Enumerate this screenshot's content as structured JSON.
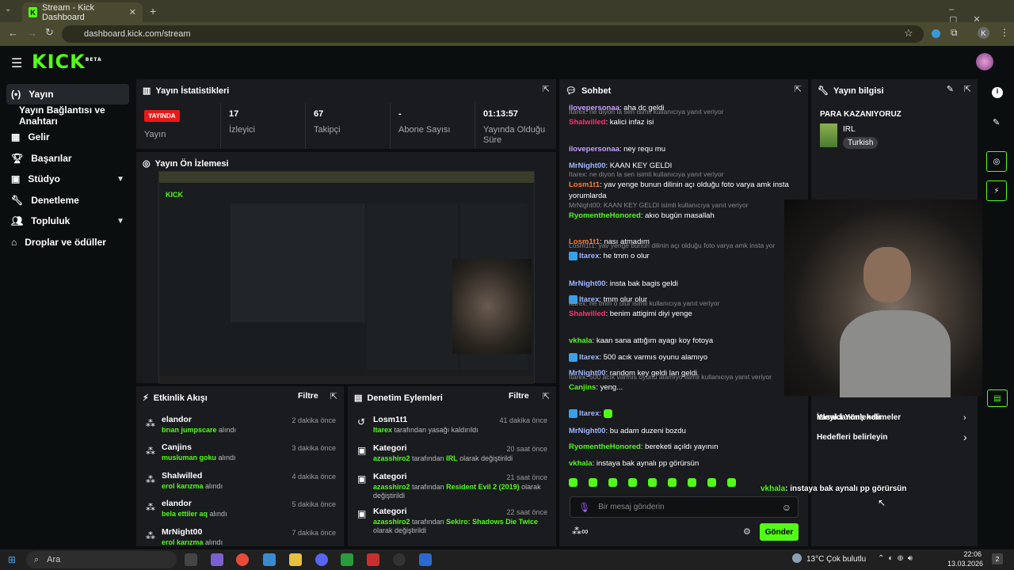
{
  "browser": {
    "tab_title": "Stream - Kick Dashboard",
    "url": "dashboard.kick.com/stream",
    "profile_initial": "K"
  },
  "brand": {
    "logo": "KICK",
    "logo_sup": "BETA",
    "accent": "#53fc18"
  },
  "sidebar": {
    "items": [
      {
        "label": "Yayın",
        "icon": "broadcast-icon"
      },
      {
        "label": "Yayın Bağlantısı ve Anahtarı",
        "icon": ""
      },
      {
        "label": "Gelir",
        "icon": "revenue-icon"
      },
      {
        "label": "Başarılar",
        "icon": "trophy-icon"
      },
      {
        "label": "Stüdyo",
        "icon": "studio-icon"
      },
      {
        "label": "Denetleme",
        "icon": "wrench-icon"
      },
      {
        "label": "Topluluk",
        "icon": "community-icon"
      },
      {
        "label": "Droplar ve ödüller",
        "icon": "gift-icon"
      }
    ]
  },
  "stats": {
    "title": "Yayın İstatistikleri",
    "live_badge": "YAYINDA",
    "status_label": "Yayın",
    "viewers": "17",
    "viewers_label": "İzleyici",
    "followers": "67",
    "followers_label": "Takipçi",
    "subs": "-",
    "subs_label": "Abone Sayısı",
    "uptime": "01:13:57",
    "uptime_label": "Yayında Olduğu Süre"
  },
  "preview": {
    "title": "Yayın Ön İzlemesi"
  },
  "activity": {
    "title": "Etkinlik Akışı",
    "filter": "Filtre",
    "events": [
      {
        "user": "elandor",
        "reward": "brıan jumpscare",
        "suffix": "alındı",
        "time": "2 dakika önce"
      },
      {
        "user": "Canjins",
        "reward": "musluman goku",
        "suffix": "alındı",
        "time": "3 dakika önce"
      },
      {
        "user": "Shalwilled",
        "reward": "erol karızma",
        "suffix": "alındı",
        "time": "4 dakika önce"
      },
      {
        "user": "elandor",
        "reward": "bela ettiler aq",
        "suffix": "alındı",
        "time": "5 dakika önce"
      },
      {
        "user": "MrNight00",
        "reward": "erol karızma",
        "suffix": "alındı",
        "time": "7 dakika önce"
      }
    ]
  },
  "modlog": {
    "title": "Denetim Eylemleri",
    "filter": "Filtre",
    "actions": [
      {
        "title": "Losm1t1",
        "actor": "Itarex",
        "text": "tarafından yasağı kaldırıldı",
        "value": "",
        "tail": "",
        "time": "41 dakika önce"
      },
      {
        "title": "Kategori",
        "actor": "azasshiro2",
        "text": "tarafından",
        "value": "IRL",
        "tail": "olarak değiştirildi",
        "time": "20 saat önce"
      },
      {
        "title": "Kategori",
        "actor": "azasshiro2",
        "text": "tarafından",
        "value": "Resident Evil 2 (2019)",
        "tail": "olarak değiştirildi",
        "time": "21 saat önce"
      },
      {
        "title": "Kategori",
        "actor": "azasshiro2",
        "text": "tarafından",
        "value": "Sekiro: Shadows Die Twice",
        "tail": "olarak değiştirildi",
        "time": "22 saat önce"
      }
    ]
  },
  "chat": {
    "title": "Sohbet",
    "placeholder": "Bir mesaj gönderin",
    "send": "Gönder",
    "messages": [
      {
        "reply": "",
        "user": "ilovepersonaa",
        "color": "#c8a0ff",
        "text": "aha dc geldi"
      },
      {
        "reply": "Itarex: ne diyon la sen isimli kullanıcıya yanıt veriyor",
        "user": "Shalwilled",
        "color": "#ff3070",
        "text": "kalici infaz isi"
      },
      {
        "reply": "",
        "user": "ilovepersonaa",
        "color": "#c8a0ff",
        "text": "ney requ mu"
      },
      {
        "reply": "",
        "user": "MrNight00",
        "color": "#9fb8ff",
        "text": "KAAN KEY GELDI"
      },
      {
        "reply": "Itarex: ne diyon la sen isimli kullanıcıya yanıt veriyor",
        "user": "Losm1t1",
        "color": "#ff7a30",
        "text": "yav yenge bunun dilinin açı olduğu foto varya amk insta yorumlarda"
      },
      {
        "reply": "MrNight00: KAAN KEY GELDI isimli kullanıcıya yanıt veriyor",
        "user": "RyomentheHonored",
        "color": "#53fc18",
        "text": "akıo bugün masallah"
      },
      {
        "reply": "",
        "user": "Losm1t1",
        "color": "#ff7a30",
        "text": "nası atmadım"
      },
      {
        "reply": "Losm1t1: yav yenge bunun dilinin açı olduğu foto varya amk insta yor",
        "user": "Itarex",
        "color": "#9fb8ff",
        "text": "he tmm o olur"
      },
      {
        "reply": "",
        "user": "MrNight00",
        "color": "#9fb8ff",
        "text": "insta bak bagis geldi"
      },
      {
        "reply": "",
        "user": "Itarex",
        "color": "#9fb8ff",
        "text": "tmm olur olur"
      },
      {
        "reply": "Itarex: he tmm o olur isimli kullanıcıya yanıt veriyor",
        "user": "Shalwilled",
        "color": "#ff3070",
        "text": "benim attigimi diyi yenge"
      },
      {
        "reply": "",
        "user": "vkhala",
        "color": "#53fc18",
        "text": "kaan sana attığım ayagı koy fotoya"
      },
      {
        "reply": "",
        "user": "Itarex",
        "color": "#9fb8ff",
        "text": "500 acık varmıs oyunu alamıyo"
      },
      {
        "reply": "",
        "user": "MrNight00",
        "color": "#9fb8ff",
        "text": "random key geldi lan geldi"
      },
      {
        "reply": "Itarex: 500 acık varmıs oyunu alamıyo isimli kullanıcıya yanıt veriyor",
        "user": "Canjins",
        "color": "#53fc18",
        "text": "yeng..."
      },
      {
        "reply": "",
        "user": "Itarex",
        "color": "#9fb8ff",
        "text": ""
      },
      {
        "reply": "",
        "user": "MrNight00",
        "color": "#9fb8ff",
        "text": "bu adam duzeni bozdu"
      },
      {
        "reply": "",
        "user": "RyomentheHonored",
        "color": "#53fc18",
        "text": "bereketi açıldı yayının"
      },
      {
        "reply": "",
        "user": "vkhala",
        "color": "#53fc18",
        "text": "instaya bak aynalı pp görürsün"
      }
    ]
  },
  "overlay_msg": {
    "user": "vkhala",
    "text": ": instaya bak aynalı pp görürsün"
  },
  "info": {
    "title": "Yayın bilgisi",
    "stream_title": "PARA KAZANIYORUZ",
    "category": "IRL",
    "tag": "Turkish",
    "menu": [
      "Yasaklanmış kelimeler",
      "İzleyici Yönlendir",
      "Hedefleri belirleyin"
    ]
  },
  "taskbar": {
    "search": "Ara",
    "weather": "13°C  Çok bulutlu",
    "time": "22:06",
    "date": "13.03.2026"
  }
}
